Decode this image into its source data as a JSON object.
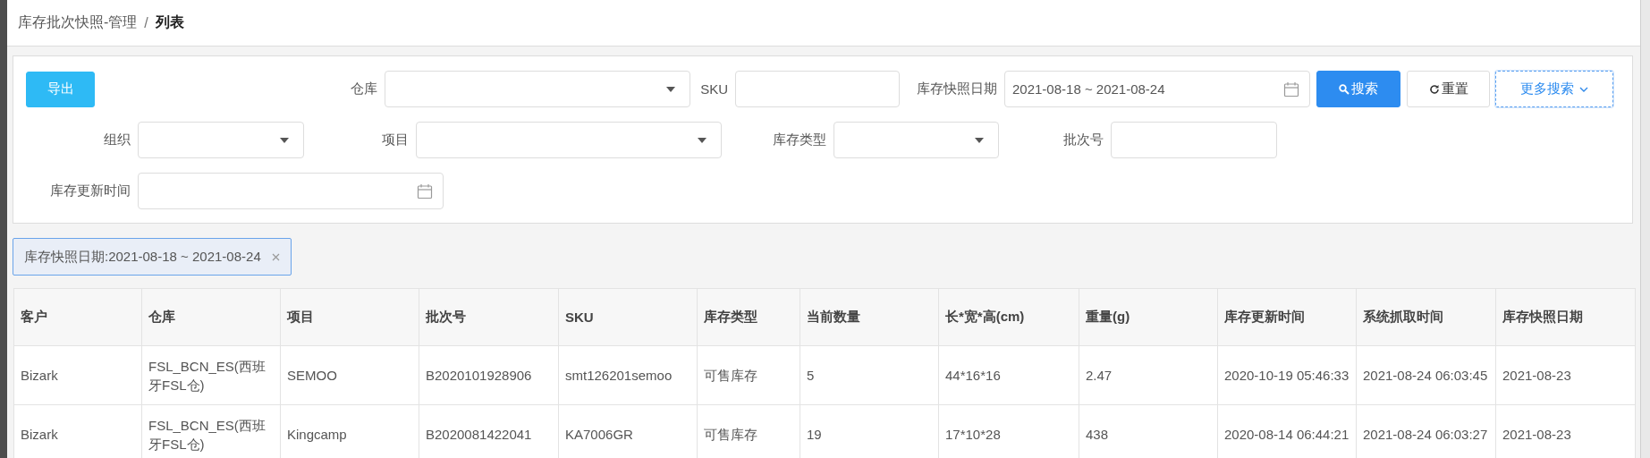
{
  "breadcrumb": {
    "items": [
      {
        "label": "库存批次快照-管理",
        "current": false
      },
      {
        "label": "列表",
        "current": true
      }
    ],
    "separator": "/"
  },
  "filter_panel": {
    "export_button": "导出",
    "fields": [
      {
        "kind": "select",
        "label": "仓库"
      },
      {
        "kind": "text",
        "label": "SKU"
      },
      {
        "kind": "date",
        "label": "库存快照日期",
        "value": "2021-08-18 ~ 2021-08-24"
      },
      {
        "kind": "select",
        "label": "组织"
      },
      {
        "kind": "select",
        "label": "项目"
      },
      {
        "kind": "select",
        "label": "库存类型"
      },
      {
        "kind": "text",
        "label": "批次号"
      },
      {
        "kind": "date",
        "label": "库存更新时间"
      }
    ],
    "buttons": [
      {
        "kind": "search",
        "label": "搜索",
        "focused": false
      },
      {
        "kind": "reset",
        "label": "重置",
        "focused": false
      },
      {
        "kind": "more",
        "label": "更多搜索",
        "focused": true
      }
    ]
  },
  "active_filters": [
    {
      "label": "库存快照日期:2021-08-18 ~ 2021-08-24"
    }
  ],
  "table": {
    "columns": [
      "客户",
      "仓库",
      "项目",
      "批次号",
      "SKU",
      "库存类型",
      "当前数量",
      "长*宽*高(cm)",
      "重量(g)",
      "库存更新时间",
      "系统抓取时间",
      "库存快照日期"
    ],
    "rows": [
      [
        "Bizark",
        "FSL_BCN_ES(西班牙FSL仓)",
        "SEMOO",
        "B2020101928906",
        "smt126201semoo",
        "可售库存",
        "5",
        "44*16*16",
        "2.47",
        "2020-10-19 05:46:33",
        "2021-08-24 06:03:45",
        "2021-08-23"
      ],
      [
        "Bizark",
        "FSL_BCN_ES(西班牙FSL仓)",
        "Kingcamp",
        "B2020081422041",
        "KA7006GR",
        "可售库存",
        "19",
        "17*10*28",
        "438",
        "2020-08-14 06:44:21",
        "2021-08-24 06:03:27",
        "2021-08-23"
      ]
    ]
  }
}
